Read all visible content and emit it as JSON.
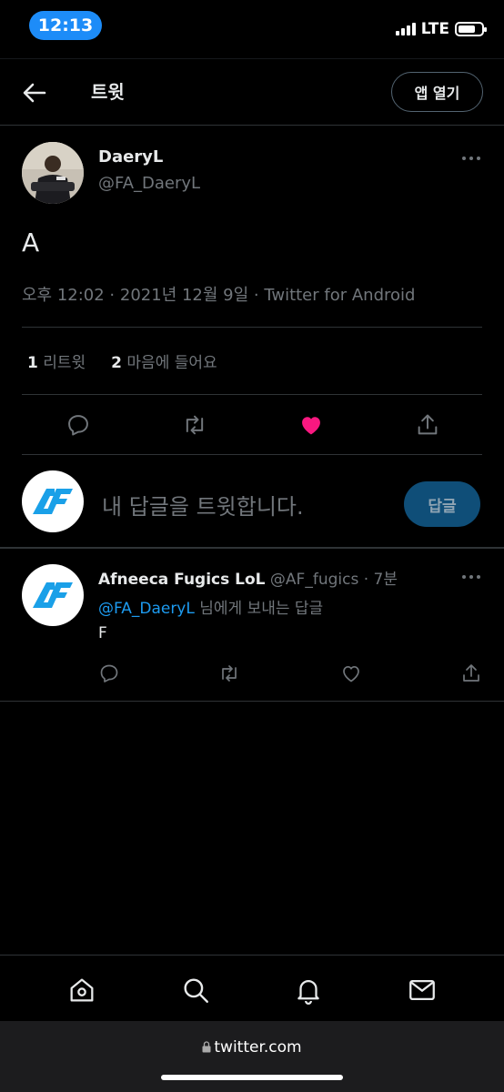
{
  "status_bar": {
    "time": "12:13",
    "network": "LTE"
  },
  "header": {
    "title": "트윗",
    "open_app_label": "앱 열기"
  },
  "tweet": {
    "author_name": "DaeryL",
    "author_handle": "@FA_DaeryL",
    "text": "A",
    "meta": "오후 12:02 · 2021년 12월 9일 · Twitter for Android",
    "retweet_count": "1",
    "retweet_label": "리트윗",
    "like_count": "2",
    "like_label": "마음에 들어요",
    "liked": true
  },
  "composer": {
    "placeholder": "내 답글을 트윗합니다.",
    "reply_button": "답글"
  },
  "reply": {
    "author_name": "Afneeca Fugics LoL",
    "author_handle": "@AF_fugics",
    "time": "· 7분",
    "reply_to_mention": "@FA_DaeryL",
    "reply_to_suffix": " 님에게 보내는 답글",
    "text": "F"
  },
  "bottom_nav": {
    "items": [
      "home-icon",
      "search-icon",
      "notifications-icon",
      "messages-icon"
    ]
  },
  "browser": {
    "url": "twitter.com"
  },
  "colors": {
    "accent": "#1d9bf0",
    "like": "#f91880",
    "background": "#000000"
  }
}
